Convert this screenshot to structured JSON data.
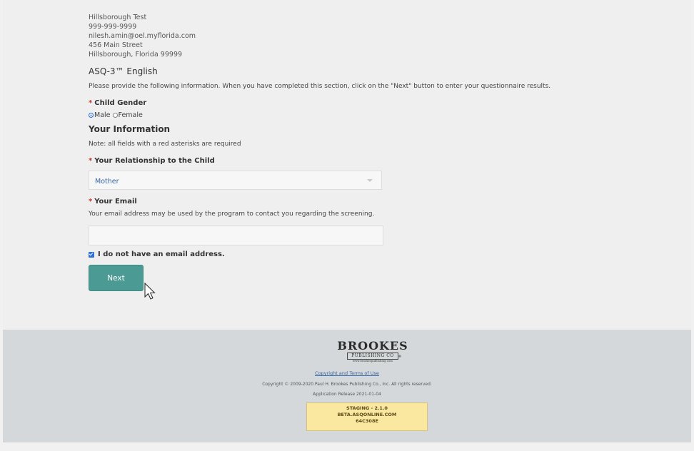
{
  "contact": {
    "name": "Hillsborough Test",
    "phone": "999-999-9999",
    "email": "nilesh.amin@oel.myflorida.com",
    "street": "456 Main Street",
    "city": "Hillsborough, Florida 99999"
  },
  "program_title": "ASQ-3™ English",
  "instructions": "Please provide the following information. When you have completed this section, click on the \"Next\" button to enter your questionnaire results.",
  "asterisk": "*",
  "gender": {
    "label": "Child Gender",
    "options": [
      "Male",
      "Female"
    ],
    "selected": "Male"
  },
  "your_info": {
    "heading": "Your Information",
    "note": "Note: all fields with a red asterisks are required"
  },
  "relationship": {
    "label": "Your Relationship to the Child",
    "value": "Mother"
  },
  "email_field": {
    "label": "Your Email",
    "help": "Your email address may be used by the program to contact you regarding the screening.",
    "value": ""
  },
  "no_email_checkbox": {
    "label": "I do not have an email address.",
    "checked": true
  },
  "next_button": "Next",
  "footer": {
    "logo_line1": "BROOKES",
    "logo_line2": "PUBLISHING CO",
    "logo_url": "www.brookespublishing.com",
    "copyright_link": "Copyright and Terms of Use",
    "copyright": "Copyright © 2009-2020 Paul H. Brookes Publishing Co., Inc. All rights reserved.",
    "release": "Application Release 2021-01-04",
    "staging_lines": [
      "STAGING - 2.1.0",
      "BETA.ASQONLINE.COM",
      "64C308E"
    ]
  },
  "colors": {
    "primary_button": "#4b9a94",
    "required": "#c0392b",
    "link": "#3465a4",
    "footer_bg": "#d5d8da",
    "staging_bg": "#fbe8a0"
  }
}
